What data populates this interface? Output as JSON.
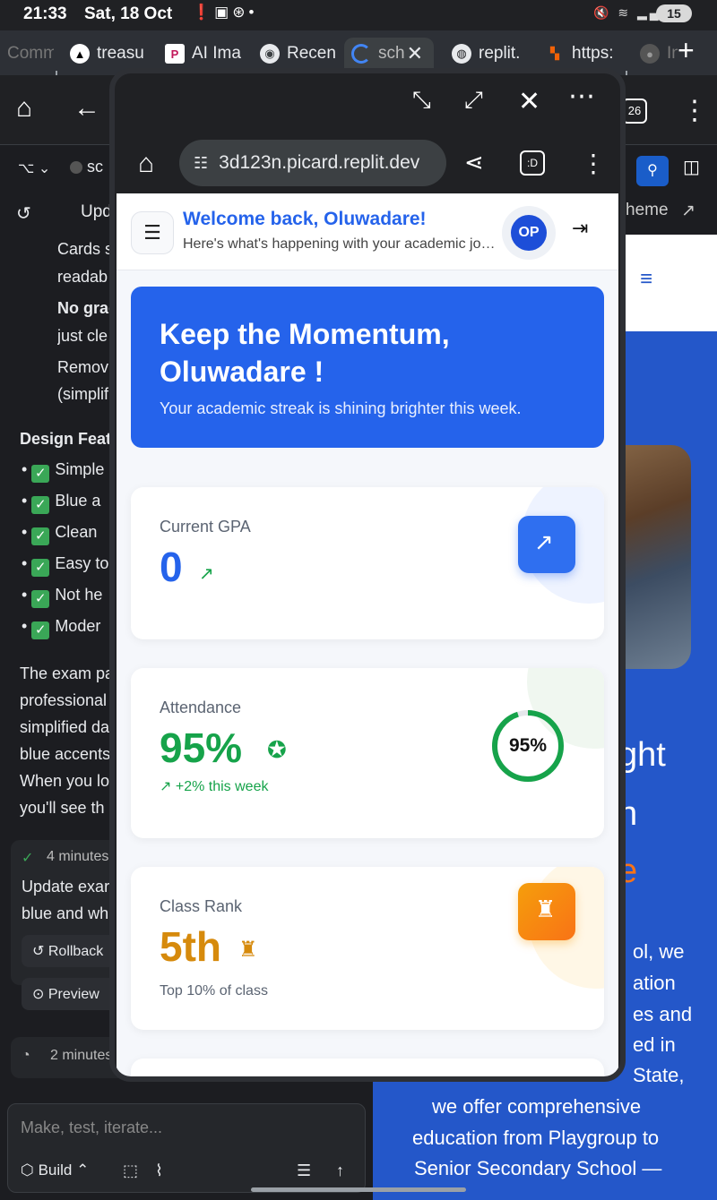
{
  "status": {
    "time": "21:33",
    "date": "Sat, 18 Oct",
    "battery": "15"
  },
  "tabs": [
    {
      "label": "Comm"
    },
    {
      "label": "treasu"
    },
    {
      "label": "AI Ima"
    },
    {
      "label": "Recen"
    },
    {
      "label": "sch"
    },
    {
      "label": "replit."
    },
    {
      "label": "https:"
    },
    {
      "label": "In"
    }
  ],
  "browser": {
    "url": "3d123n.picard.replit.dev",
    "tab_count": "26"
  },
  "left": {
    "file_label": "sc",
    "update_label": "Upd",
    "bullets": [
      {
        "line1": "Cards s",
        "line2": "readab"
      },
      {
        "line1": "No grad",
        "line2": "just cle"
      },
      {
        "line1": "Remov",
        "line2": "(simplif"
      }
    ],
    "design_heading": "Design Feat",
    "features": [
      "Simple",
      "Blue a",
      "Clean",
      "Easy to",
      "Not he",
      "Moder"
    ],
    "paragraph": [
      "The exam pa",
      "professional",
      "simplified da",
      "blue accents",
      "When you lo",
      "you'll see th"
    ],
    "msg_time": "4 minutes",
    "msg_text": [
      "Update exar",
      "blue and wh"
    ],
    "rollback": "Rollback",
    "preview": "Preview",
    "msg2_time": "2 minutes",
    "prompt_placeholder": "Make, test, iterate...",
    "build_label": "Build"
  },
  "right": {
    "theme_label": "heme",
    "hero_words": [
      "ght",
      "n",
      "e"
    ],
    "body_lines": [
      "ol, we",
      "ation",
      "es and",
      "ed in",
      "State,",
      "we offer comprehensive",
      "education from Playgroup to",
      "Senior Secondary School —"
    ]
  },
  "app": {
    "welcome": "Welcome back, Oluwadare!",
    "subtitle": "Here's what's happening with your academic journey",
    "avatar_initials": "OP",
    "hero_title": "Keep the Momentum, Oluwadare !",
    "hero_subtitle": "Your academic streak is shining brighter this week.",
    "gpa": {
      "label": "Current GPA",
      "value": "0"
    },
    "attendance": {
      "label": "Attendance",
      "value": "95%",
      "delta": "+2% this week",
      "ring_label": "95%",
      "percent": 95
    },
    "rank": {
      "label": "Class Rank",
      "value": "5th",
      "note": "Top 10% of class"
    }
  },
  "colors": {
    "primary": "#2563eb",
    "attendance_green": "#16a34a",
    "rank_orange": "#d68a0c"
  }
}
